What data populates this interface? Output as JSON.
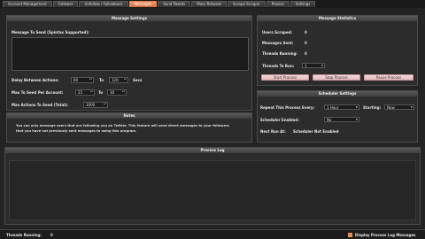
{
  "tabs": [
    {
      "label": "Account Management",
      "active": false
    },
    {
      "label": "Follower",
      "active": false
    },
    {
      "label": "Unfollow / Followback",
      "active": false
    },
    {
      "label": "Messages",
      "active": true
    },
    {
      "label": "Send Tweets",
      "active": false
    },
    {
      "label": "Mass Retweet",
      "active": false
    },
    {
      "label": "Scrape Scraper",
      "active": false
    },
    {
      "label": "Proxies",
      "active": false
    },
    {
      "label": "Settings",
      "active": false
    }
  ],
  "message_settings": {
    "title": "Message Settings",
    "message_label": "Message To Send (Spintax Supported):",
    "message_value": "",
    "delay_label": "Delay Between Actions:",
    "delay_min": "60",
    "delay_to": "To",
    "delay_max": "120",
    "delay_unit": "Secs",
    "max_send_label": "Max To Send Per Account:",
    "max_send_min": "25",
    "max_send_to": "To",
    "max_send_max": "30",
    "max_actions_label": "Max Actions To Send (Total):",
    "max_actions_value": "1000"
  },
  "notes": {
    "title": "Notes",
    "text": "You can only message users that are following you on Twitter. This feature will send direct messages to your followers that you have not previously sent messages to using this program."
  },
  "message_statistics": {
    "title": "Message Statistics",
    "users_scraped_label": "Users Scraped:",
    "users_scraped_value": "0",
    "messages_sent_label": "Messages Sent:",
    "messages_sent_value": "0",
    "threads_running_label": "Threads Running:",
    "threads_running_value": "0",
    "threads_to_run_label": "Threads To Run:",
    "threads_to_run_value": "1",
    "start_button": "Start Process",
    "stop_button": "Stop Process",
    "pause_button": "Pause Process"
  },
  "scheduler": {
    "title": "Scheduler Settings",
    "repeat_label": "Repeat This Process Every:",
    "repeat_value": "1 Hour",
    "starting_label": "Starting:",
    "starting_value": "Now",
    "enabled_label": "Scheduler Enabled:",
    "enabled_value": "No",
    "next_run_label": "Next Run At:",
    "next_run_value": "Scheduler Not Enabled"
  },
  "process_log": {
    "title": "Process Log"
  },
  "status": {
    "threads_label": "Threads Running:",
    "threads_value": "0",
    "display_log_label": "Display Process Log Messages"
  },
  "colors": {
    "accent": "#e08040",
    "button": "#e8c0c0",
    "panel": "#2c2c2c"
  }
}
